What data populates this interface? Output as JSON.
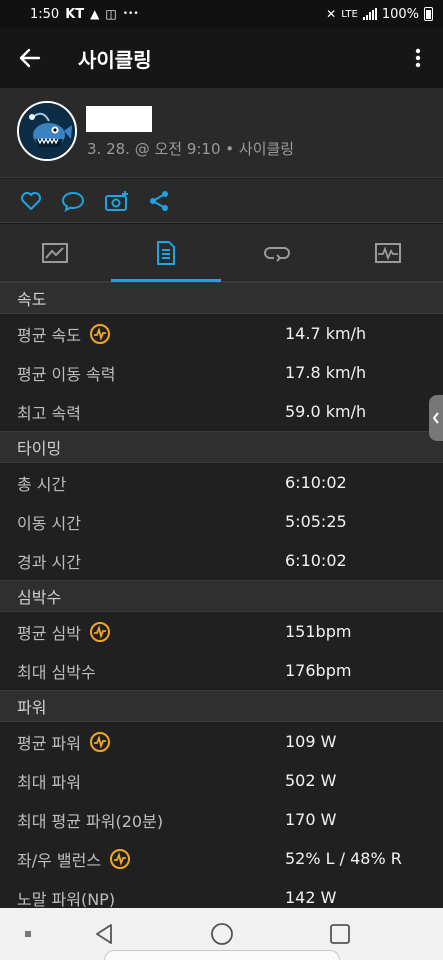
{
  "status_bar": {
    "time": "1:50",
    "carrier": "KT",
    "battery": "100%"
  },
  "app_bar": {
    "title": "사이클링"
  },
  "profile": {
    "meta": "3. 28. @ 오전 9:10 • 사이클링"
  },
  "actions": [
    "like-icon",
    "comment-icon",
    "add-photo-icon",
    "share-icon"
  ],
  "tabs": [
    "chart-tab-icon",
    "stats-tab-icon",
    "laps-tab-icon",
    "graph-tab-icon"
  ],
  "colors": {
    "accent": "#1ea3e3",
    "badge": "#f5a623",
    "background": "#202020",
    "section": "#2f2f2f"
  },
  "stats": {
    "speed": {
      "header": "속도",
      "rows": [
        {
          "label": "평균 속도",
          "value": "14.7 km/h"
        },
        {
          "label": "평균 이동 속력",
          "value": "17.8 km/h"
        },
        {
          "label": "최고 속력",
          "value": "59.0 km/h"
        }
      ]
    },
    "timing": {
      "header": "타이밍",
      "rows": [
        {
          "label": "총 시간",
          "value": "6:10:02"
        },
        {
          "label": "이동 시간",
          "value": "5:05:25"
        },
        {
          "label": "경과 시간",
          "value": "6:10:02"
        }
      ]
    },
    "heart_rate": {
      "header": "심박수",
      "rows": [
        {
          "label": "평균 심박",
          "value": "151bpm"
        },
        {
          "label": "최대 심박수",
          "value": "176bpm"
        }
      ]
    },
    "power": {
      "header": "파워",
      "rows": [
        {
          "label": "평균 파워",
          "value": "109 W"
        },
        {
          "label": "최대 파워",
          "value": "502 W"
        },
        {
          "label": "최대 평균 파워(20분)",
          "value": "170 W"
        },
        {
          "label": "좌/우 밸런스",
          "value": "52% L / 48% R"
        },
        {
          "label": "노말 파워(NP)",
          "value": "142 W"
        }
      ]
    }
  }
}
